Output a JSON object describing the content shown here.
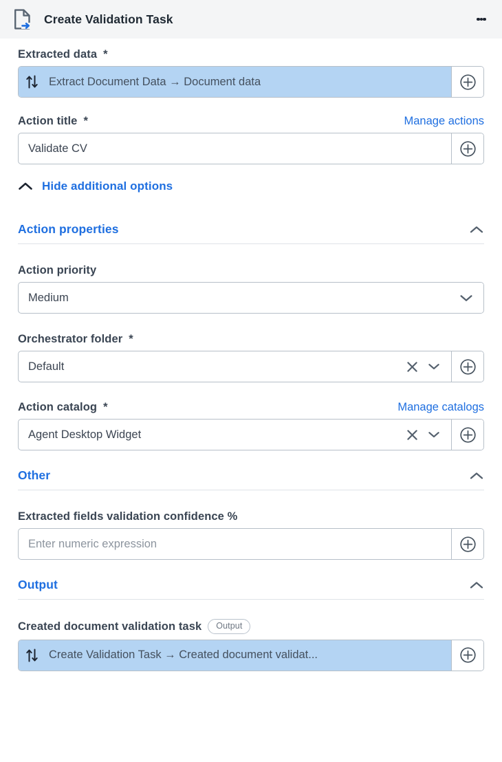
{
  "header": {
    "title": "Create Validation Task",
    "icon": "document-arrow-icon",
    "menu_icon": "more-vertical-icon"
  },
  "fields": {
    "extracted_data": {
      "label": "Extracted data",
      "required_marker": "*",
      "value": "Extract Document Data → Document data",
      "expression_icon": "arrows-up-down-icon",
      "add_icon": "plus-circle-icon"
    },
    "action_title": {
      "label": "Action title",
      "required_marker": "*",
      "link_label": "Manage actions",
      "value": "Validate CV",
      "add_icon": "plus-circle-icon"
    },
    "action_priority": {
      "label": "Action priority",
      "value": "Medium",
      "options": [
        "Medium"
      ],
      "chevron_icon": "chevron-down-icon"
    },
    "orchestrator_folder": {
      "label": "Orchestrator folder",
      "required_marker": "*",
      "value": "Default",
      "clear_icon": "close-icon",
      "chevron_icon": "chevron-down-icon",
      "add_icon": "plus-circle-icon"
    },
    "action_catalog": {
      "label": "Action catalog",
      "required_marker": "*",
      "link_label": "Manage catalogs",
      "value": "Agent Desktop Widget",
      "clear_icon": "close-icon",
      "chevron_icon": "chevron-down-icon",
      "add_icon": "plus-circle-icon"
    },
    "confidence": {
      "label": "Extracted fields validation confidence %",
      "value": "",
      "placeholder": "Enter numeric expression",
      "add_icon": "plus-circle-icon"
    },
    "created_task": {
      "label": "Created document validation task",
      "badge": "Output",
      "value": "Create Validation Task → Created document validat...",
      "expression_icon": "arrows-up-down-icon",
      "add_icon": "plus-circle-icon"
    }
  },
  "toggle": {
    "label": "Hide additional options",
    "icon": "chevron-up-icon"
  },
  "sections": {
    "action_properties": {
      "title": "Action properties",
      "icon": "chevron-up-icon"
    },
    "other": {
      "title": "Other",
      "icon": "chevron-up-icon"
    },
    "output": {
      "title": "Output",
      "icon": "chevron-up-icon"
    }
  },
  "colors": {
    "accent": "#1f6fe0",
    "expression_highlight": "#b4d4f3",
    "header_bg": "#f4f5f6",
    "label": "#3a4553",
    "border": "#b6bfc8"
  }
}
